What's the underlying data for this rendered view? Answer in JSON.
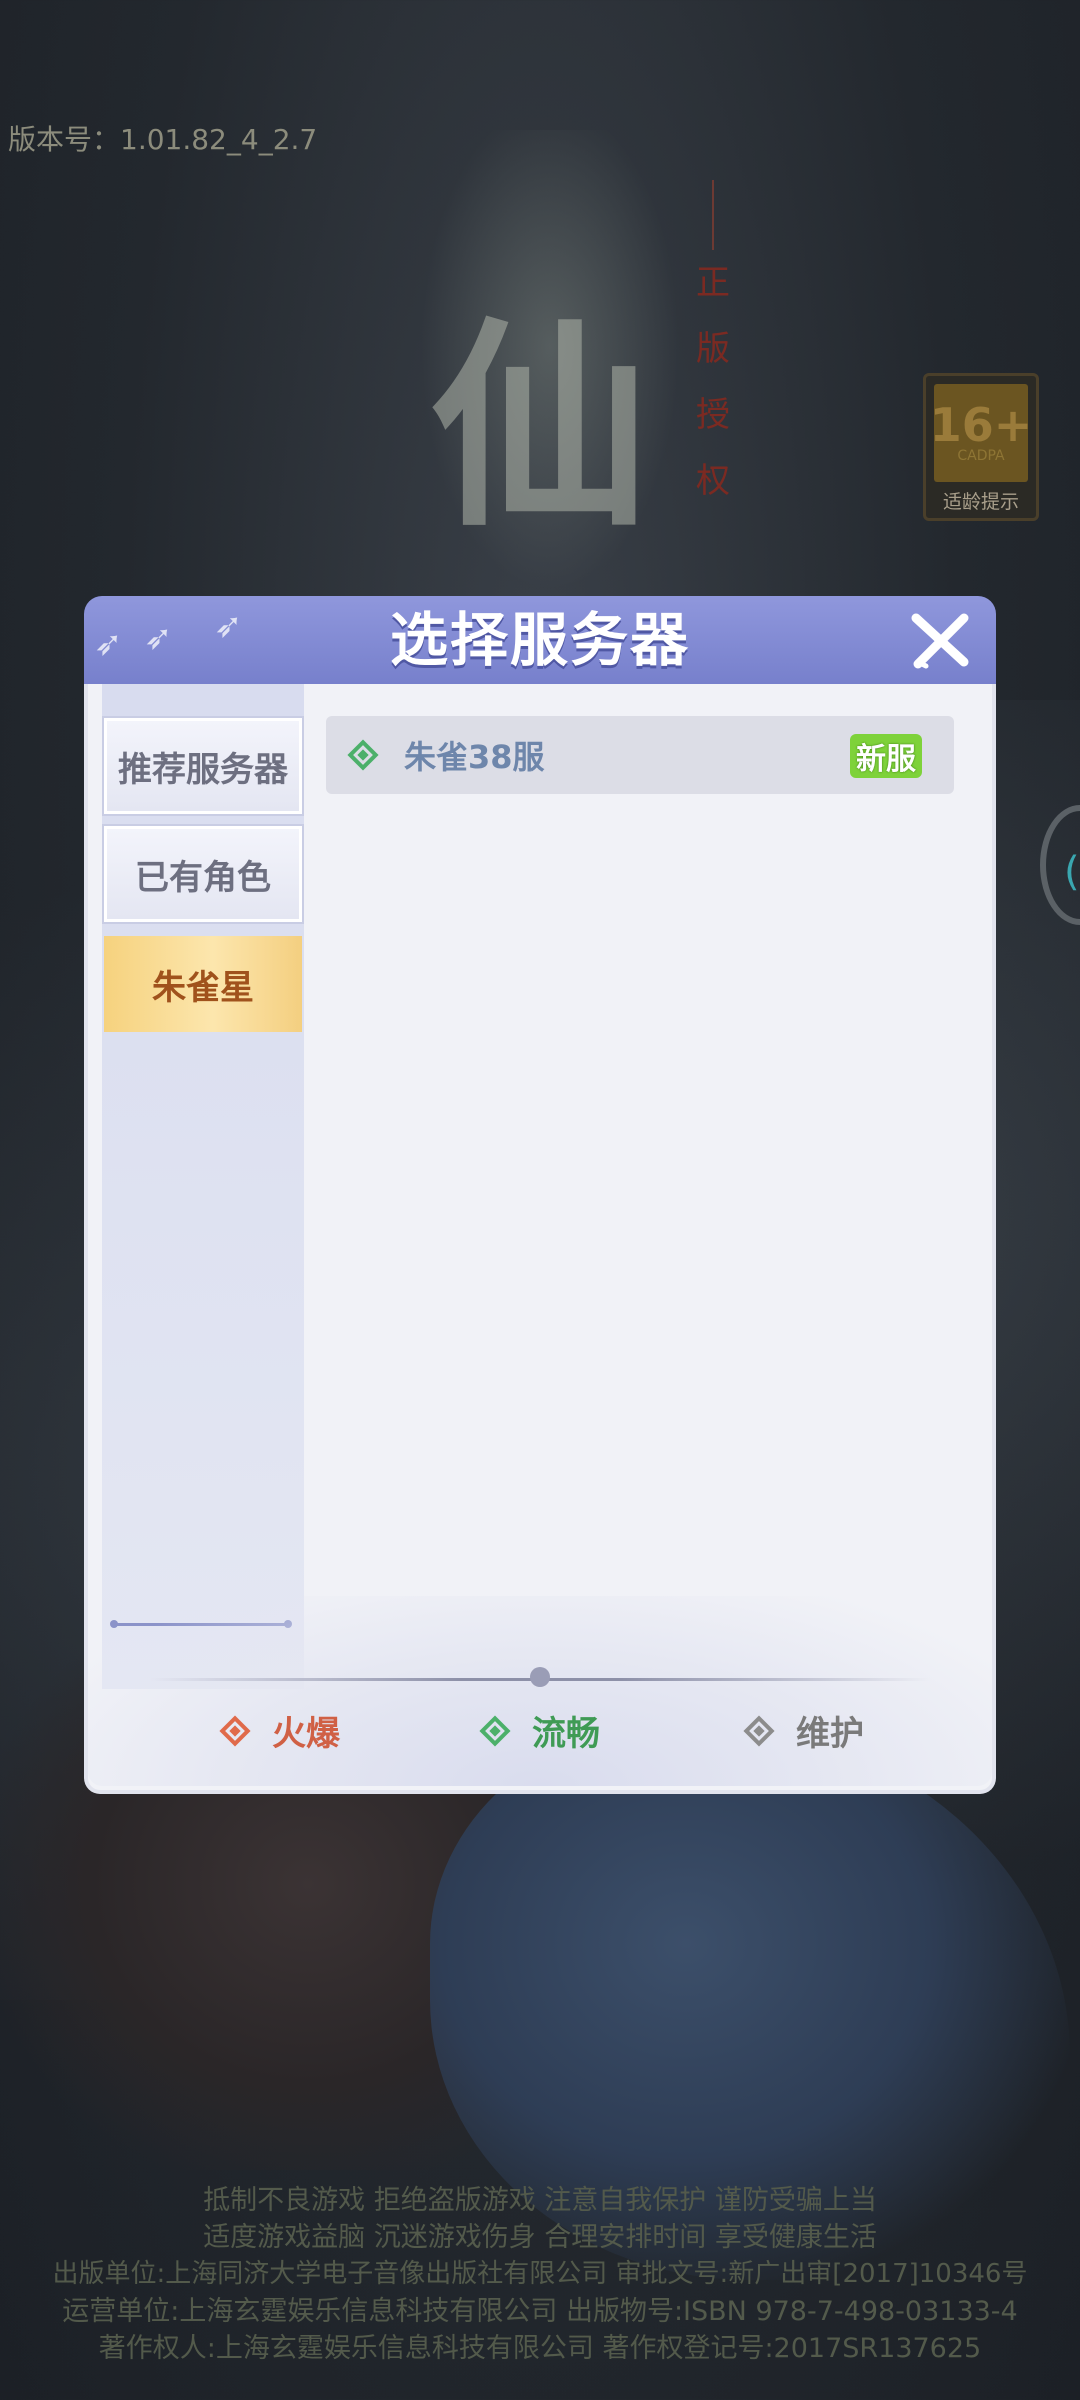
{
  "version_text": "版本号：1.01.82_4_2.7",
  "authorization_text": "正版授权",
  "age_rating": {
    "number": "16+",
    "org": "CADPA",
    "label": "适龄提示"
  },
  "background_glyph": "仙",
  "dialog": {
    "title": "选择服务器",
    "tabs": [
      {
        "label": "推荐服务器",
        "active": false
      },
      {
        "label": "已有角色",
        "active": false
      },
      {
        "label": "朱雀星",
        "active": true
      }
    ],
    "servers": [
      {
        "name": "朱雀38服",
        "status": "smooth",
        "badge": "新服"
      }
    ],
    "legend": {
      "hot": "火爆",
      "smooth": "流畅",
      "maintenance": "维护"
    }
  },
  "footer_lines": [
    "抵制不良游戏 拒绝盗版游戏 注意自我保护 谨防受骗上当",
    "适度游戏益脑 沉迷游戏伤身 合理安排时间 享受健康生活",
    "出版单位:上海同济大学电子音像出版社有限公司 审批文号:新广出审[2017]10346号",
    "运营单位:上海玄霆娱乐信息科技有限公司 出版物号:ISBN 978-7-498-03133-4",
    "著作权人:上海玄霆娱乐信息科技有限公司 著作权登记号:2017SR137625"
  ],
  "colors": {
    "header": "#7f88d4",
    "hot": "#d06045",
    "smooth": "#3f9b55",
    "maintenance": "#7a7a7a",
    "new_badge": "#7ed23a"
  }
}
